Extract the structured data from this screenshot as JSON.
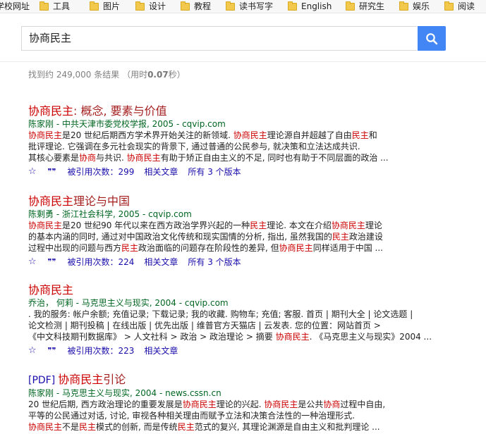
{
  "bookmarks": [
    "学校网址",
    "工具",
    "图片",
    "设计",
    "教程",
    "读书写字",
    "English",
    "研究生",
    "娱乐",
    "阅读"
  ],
  "search": {
    "query": "协商民主"
  },
  "stats": {
    "prefix": "找到约 249,000 条结果 （用时",
    "time": "0.07",
    "suffix": "秒）"
  },
  "results": [
    {
      "title_parts": [
        {
          "t": "协商民主",
          "hl": true
        },
        {
          "t": ": 概念, 要素与价值",
          "hl": false
        }
      ],
      "pdf": "",
      "source": "陈家刚 - 中共天津市委党校学报, 2005 - cqvip.com",
      "snippet": [
        [
          {
            "t": "协商民主",
            "hl": true
          },
          {
            "t": "是20 世纪后期西方学术界开始关注的新领域. ",
            "hl": false
          },
          {
            "t": "协商民主",
            "hl": true
          },
          {
            "t": "理论源自并超越了自由",
            "hl": false
          },
          {
            "t": "民主",
            "hl": true
          },
          {
            "t": "和",
            "hl": false
          }
        ],
        [
          {
            "t": "批评理论. 它强调在多元社会现实的背景下, 通过普通的公民参与, 就决策和立法达成共识.",
            "hl": false
          }
        ],
        [
          {
            "t": "其核心要素是",
            "hl": false
          },
          {
            "t": "协商",
            "hl": true
          },
          {
            "t": "与共识. ",
            "hl": false
          },
          {
            "t": "协商民主",
            "hl": true
          },
          {
            "t": "有助于矫正自由主义的不足, 同时也有助于不同层面的政治 ...",
            "hl": false
          }
        ]
      ],
      "links": [
        "被引用次数：299",
        "相关文章",
        "所有 3 个版本"
      ]
    },
    {
      "title_parts": [
        {
          "t": "协商民主",
          "hl": true
        },
        {
          "t": "理论与中国",
          "hl": false
        }
      ],
      "pdf": "",
      "source": "陈剩勇 - 浙江社会科学, 2005 - cqvip.com",
      "snippet": [
        [
          {
            "t": "协商民主",
            "hl": true
          },
          {
            "t": "是20 世纪90 年代以来在西方政治学界兴起的一种",
            "hl": false
          },
          {
            "t": "民主",
            "hl": true
          },
          {
            "t": "理论. 本文在介绍",
            "hl": false
          },
          {
            "t": "协商民主",
            "hl": true
          },
          {
            "t": "理论",
            "hl": false
          }
        ],
        [
          {
            "t": "的基本内涵的同时, 通过对中国政治文化传统和现实国情的分析, 指出, 虽然我国的",
            "hl": false
          },
          {
            "t": "民主",
            "hl": true
          },
          {
            "t": "政治建设",
            "hl": false
          }
        ],
        [
          {
            "t": "过程中出现的问题与西方",
            "hl": false
          },
          {
            "t": "民主",
            "hl": true
          },
          {
            "t": "政治面临的问题存在阶段性的差异, 但",
            "hl": false
          },
          {
            "t": "协商民主",
            "hl": true
          },
          {
            "t": "同样适用于中国 ...",
            "hl": false
          }
        ]
      ],
      "links": [
        "被引用次数：224",
        "相关文章",
        "所有 3 个版本"
      ]
    },
    {
      "title_parts": [
        {
          "t": "协商民主",
          "hl": true
        }
      ],
      "pdf": "",
      "source": "乔治， 何莉 - 马克思主义与现实, 2004 - cqvip.com",
      "snippet": [
        [
          {
            "t": ". 我的服务: 帐户余额; 充值记录; 下载记录; 我的收藏. 购物车; 充值; 客服. 首页 | 期刊大全 | 论文选题 |",
            "hl": false
          }
        ],
        [
          {
            "t": "论文检测 | 期刊投稿 | 在线出版 | 优先出版 | 维普官方天猫店 | 云发表. 您的位置：网站首页 >",
            "hl": false
          }
        ],
        [
          {
            "t": "《中文科技期刊数据库》 > 人文社科 > 政治 > 政治理论 > 摘要 ",
            "hl": false
          },
          {
            "t": "协商民主",
            "hl": true
          },
          {
            "t": ". 《马克思主义与现实》2004 ...",
            "hl": false
          }
        ]
      ],
      "links": [
        "被引用次数：223",
        "相关文章"
      ]
    },
    {
      "title_parts": [
        {
          "t": "协商民主",
          "hl": true
        },
        {
          "t": "引论",
          "hl": false
        }
      ],
      "pdf": "[PDF]",
      "source": "陈家刚 - 马克思主义与现实, 2004 - news.cssn.cn",
      "snippet": [
        [
          {
            "t": "20 世纪后期, 西方政治理论的重要发展是",
            "hl": false
          },
          {
            "t": "协商民主",
            "hl": true
          },
          {
            "t": "理论的兴起. ",
            "hl": false
          },
          {
            "t": "协商民主",
            "hl": true
          },
          {
            "t": "是公共",
            "hl": false
          },
          {
            "t": "协商",
            "hl": true
          },
          {
            "t": "过程中自由,",
            "hl": false
          }
        ],
        [
          {
            "t": "平等的公民通过对话, 讨论, 审视各种相关理由而赋予立法和决策合法性的一种治理形式.",
            "hl": false
          }
        ],
        [
          {
            "t": "协商民主",
            "hl": true
          },
          {
            "t": "不是",
            "hl": false
          },
          {
            "t": "民主",
            "hl": true
          },
          {
            "t": "模式的创新, 而是传统",
            "hl": false
          },
          {
            "t": "民主",
            "hl": true
          },
          {
            "t": "范式的复兴, 其理论渊源是自由主义和批判理论 ...",
            "hl": false
          }
        ]
      ],
      "links": []
    }
  ],
  "icons": {
    "search": "search-icon",
    "star": "star-icon",
    "quote": "quote-icon",
    "folder": "folder-icon"
  },
  "colors": {
    "title": "#a41e1e",
    "highlight": "#cc0000",
    "source": "#006621",
    "link": "#1a0dab",
    "button": "#4285f4"
  }
}
